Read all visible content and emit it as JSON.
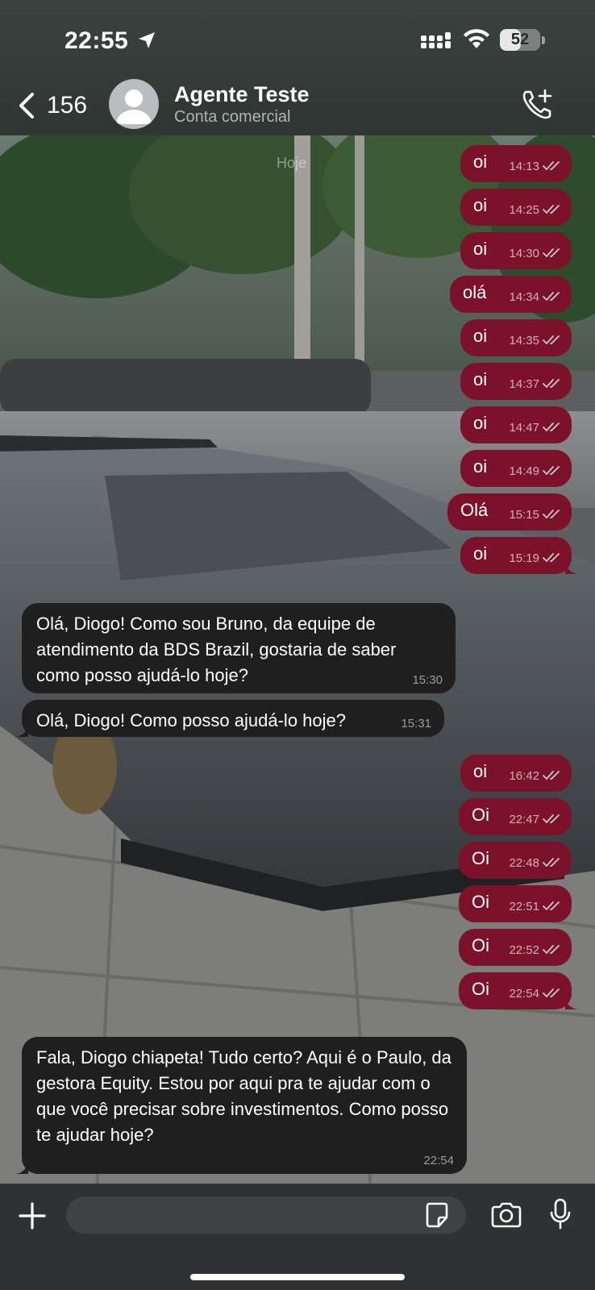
{
  "status_bar": {
    "time": "22:55",
    "battery_level": "52",
    "battery_fraction": 0.52
  },
  "header": {
    "back_count": "156",
    "contact_name": "Agente Teste",
    "contact_subtitle": "Conta comercial"
  },
  "chat": {
    "date_chip": "Hoje",
    "messages": [
      {
        "direction": "out",
        "text": "oi",
        "time": "14:13",
        "status": "read"
      },
      {
        "direction": "out",
        "text": "oi",
        "time": "14:25",
        "status": "read"
      },
      {
        "direction": "out",
        "text": "oi",
        "time": "14:30",
        "status": "read"
      },
      {
        "direction": "out",
        "text": "olá",
        "time": "14:34",
        "status": "read"
      },
      {
        "direction": "out",
        "text": "oi",
        "time": "14:35",
        "status": "read"
      },
      {
        "direction": "out",
        "text": "oi",
        "time": "14:37",
        "status": "read"
      },
      {
        "direction": "out",
        "text": "oi",
        "time": "14:47",
        "status": "read"
      },
      {
        "direction": "out",
        "text": "oi",
        "time": "14:49",
        "status": "read"
      },
      {
        "direction": "out",
        "text": "Olá",
        "time": "15:15",
        "status": "read"
      },
      {
        "direction": "out",
        "text": "oi",
        "time": "15:19",
        "status": "read"
      },
      {
        "direction": "in",
        "text": "Olá, Diogo! Como sou Bruno, da equipe de atendimento da BDS Brazil, gostaria de saber como posso ajudá-lo hoje?",
        "time": "15:30"
      },
      {
        "direction": "in",
        "text": "Olá, Diogo! Como posso ajudá-lo hoje?",
        "time": "15:31"
      },
      {
        "direction": "out",
        "text": "oi",
        "time": "16:42",
        "status": "read"
      },
      {
        "direction": "out",
        "text": "Oi",
        "time": "22:47",
        "status": "read"
      },
      {
        "direction": "out",
        "text": "Oi",
        "time": "22:48",
        "status": "read"
      },
      {
        "direction": "out",
        "text": "Oi",
        "time": "22:51",
        "status": "read"
      },
      {
        "direction": "out",
        "text": "Oi",
        "time": "22:52",
        "status": "read"
      },
      {
        "direction": "out",
        "text": "Oi",
        "time": "22:54",
        "status": "read"
      },
      {
        "direction": "in",
        "text": "Fala, Diogo chiapeta! Tudo certo? Aqui é o Paulo, da gestora Equity. Estou por aqui pra te ajudar com o que você precisar sobre investimentos. Como posso te ajudar hoje?",
        "time": "22:54"
      }
    ]
  },
  "input_bar": {
    "placeholder": ""
  },
  "colors": {
    "outgoing_bubble": "#7b1229",
    "incoming_bubble": "#1f1f1f",
    "read_ticks": "#c9c9d6",
    "input_bar_bg": "#2f3133"
  },
  "icons": [
    "location-arrow-icon",
    "signal-icon",
    "wifi-icon",
    "battery-icon",
    "chevron-left-icon",
    "avatar-person-icon",
    "phone-plus-icon",
    "plus-icon",
    "sticker-icon",
    "camera-icon",
    "microphone-icon",
    "double-check-icon"
  ]
}
